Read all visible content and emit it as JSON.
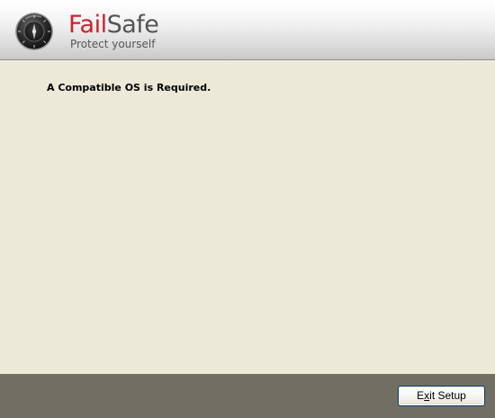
{
  "header": {
    "brand_part1": "Fail",
    "brand_part2": "Safe",
    "tagline": "Protect yourself",
    "brand_colors": {
      "fail": "#c8242c",
      "safe": "#555555"
    },
    "logo_icon": "vault-dial-icon"
  },
  "main": {
    "message": "A Compatible OS is Required."
  },
  "footer": {
    "exit_button": {
      "before": "E",
      "accel": "x",
      "after": "it Setup"
    }
  }
}
